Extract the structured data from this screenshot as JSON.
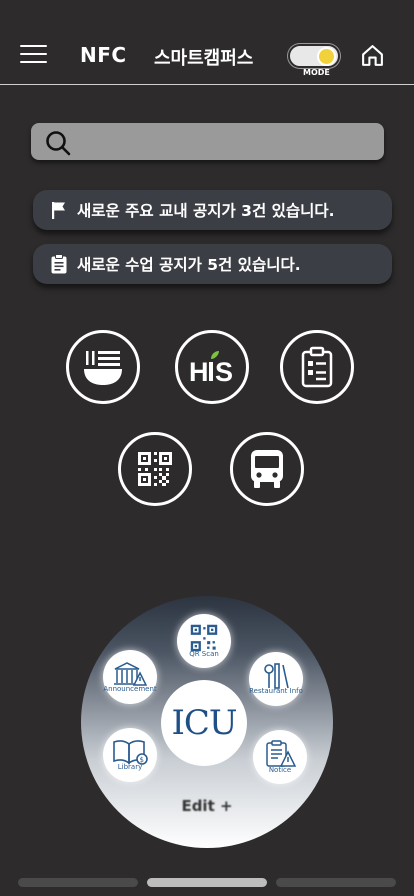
{
  "header": {
    "nfc_label": "NFC",
    "title": "스마트캠퍼스",
    "mode_label": "MODE",
    "menu_icon": "hamburger-menu-icon",
    "home_icon": "home-icon",
    "toggle_state": "on"
  },
  "search": {
    "icon": "search-icon",
    "placeholder": ""
  },
  "notices": [
    {
      "icon": "flag-icon",
      "text": "새로운 주요 교내 공지가 3건 있습니다."
    },
    {
      "icon": "clipboard-icon",
      "text": "새로운 수업 공지가 5건 있습니다."
    }
  ],
  "quick_icons": [
    {
      "name": "meal-icon"
    },
    {
      "name": "his-icon",
      "text": "HIS"
    },
    {
      "name": "checklist-icon"
    },
    {
      "name": "qr-code-icon"
    },
    {
      "name": "bus-icon"
    }
  ],
  "wheel": {
    "logo_text": "ICU",
    "edit_label": "Edit +",
    "items": [
      {
        "label": "QR Scan",
        "icon": "qr-code-icon"
      },
      {
        "label": "Announcement",
        "icon": "building-icon"
      },
      {
        "label": "Restaurant Info",
        "icon": "utensils-icon"
      },
      {
        "label": "Library",
        "icon": "book-icon"
      },
      {
        "label": "Notice",
        "icon": "clipboard-warning-icon"
      }
    ]
  },
  "pager": {
    "pages": 3,
    "active": 2
  },
  "colors": {
    "background": "#2d2b2b",
    "notice_bg": "#3b3e44",
    "toggle_knob": "#f1d23a",
    "logo_blue": "#1f4f87"
  }
}
